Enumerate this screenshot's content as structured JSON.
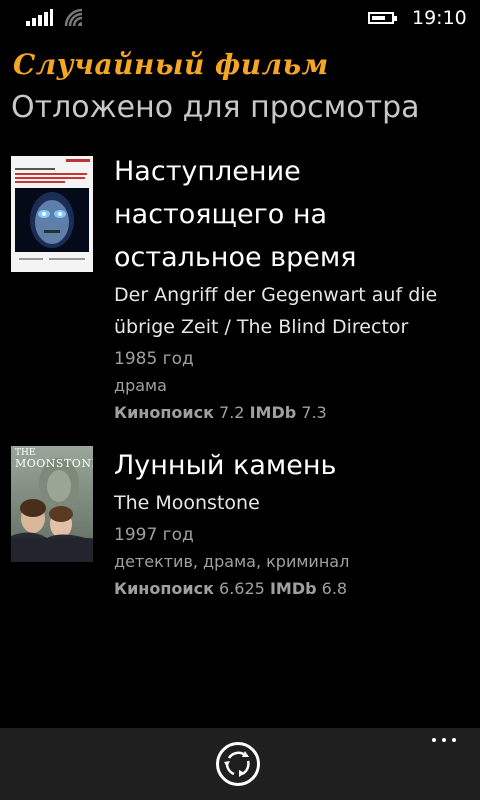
{
  "status_bar": {
    "time": "19:10",
    "icons": [
      "signal-icon",
      "wifi-icon",
      "battery-icon"
    ]
  },
  "header": {
    "app_title": "Случайный фильм",
    "page_title": "Отложено для просмотра",
    "accent_color": "#f5a623"
  },
  "movies": [
    {
      "title_lines": [
        "Наступление",
        "настоящего на",
        "остальное время"
      ],
      "original_lines": [
        "Der Angriff der Gegenwart auf die",
        "übrige Zeit / The Blind Director"
      ],
      "year": "1985 год",
      "genres": "драма",
      "rating_kp_label": "Кинопоиск",
      "rating_kp": "7.2",
      "rating_imdb_label": "IMDb",
      "rating_imdb": "7.3"
    },
    {
      "title_lines": [
        "Лунный камень"
      ],
      "original_lines": [
        "The Moonstone"
      ],
      "year": "1997 год",
      "genres": "детектив, драма, криминал",
      "rating_kp_label": "Кинопоиск",
      "rating_kp": "6.625",
      "rating_imdb_label": "IMDb",
      "rating_imdb": "6.8",
      "poster_text": {
        "title_small": "THE",
        "title_large": "MOONSTONE"
      }
    }
  ],
  "app_bar": {
    "icons": [
      "refresh-icon",
      "more-icon"
    ]
  }
}
